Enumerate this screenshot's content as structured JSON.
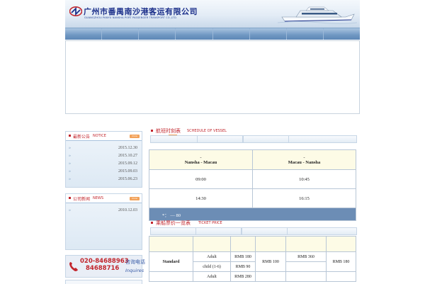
{
  "header": {
    "company_cn": "广州市番禺南沙港客运有限公司",
    "company_en": "GUANGZHOU PANYU NANSHA PORT PASSENGER TRANSPORT CO.,LTD."
  },
  "notice": {
    "title_cn": "最新公告",
    "title_en": "NOTICE",
    "more": "more",
    "dates": [
      "2015.12.30",
      "2015.10.27",
      "2015.09.12",
      "2015.09.03",
      "2015.06.23"
    ]
  },
  "news": {
    "title_cn": "公司新闻",
    "title_en": "NEWS",
    "more": "more",
    "dates": [
      "2010.12.03"
    ]
  },
  "hotline": {
    "number1": "020-84688963",
    "number2": "84688716",
    "label_cn": "咨询电话",
    "label_en": "Inquires"
  },
  "schedule": {
    "title_cn": "航班时刻表",
    "title_en": "SCHEDULE OF VESSEL",
    "tag": "more",
    "route1_dash": "-",
    "route1": "Nansha - Macau",
    "route2_dash": "-",
    "route2": "Macau - Nansha",
    "rows": [
      [
        "09:00",
        "10:45"
      ],
      [
        "14:30",
        "16:15"
      ]
    ],
    "footer": "*： — 80"
  },
  "ticket": {
    "title_cn": "乘船票价一览表",
    "title_en": "TICKET PRICE",
    "standard": "Standard",
    "adult": "Adult",
    "child": "child (1-6)",
    "adult2": "Adult",
    "p180": "RMB 180",
    "p90": "RMB 90",
    "p100": "RMB 100",
    "p360": "RMB 360",
    "p180b": "RMB 180",
    "p280": "RMB 280"
  }
}
